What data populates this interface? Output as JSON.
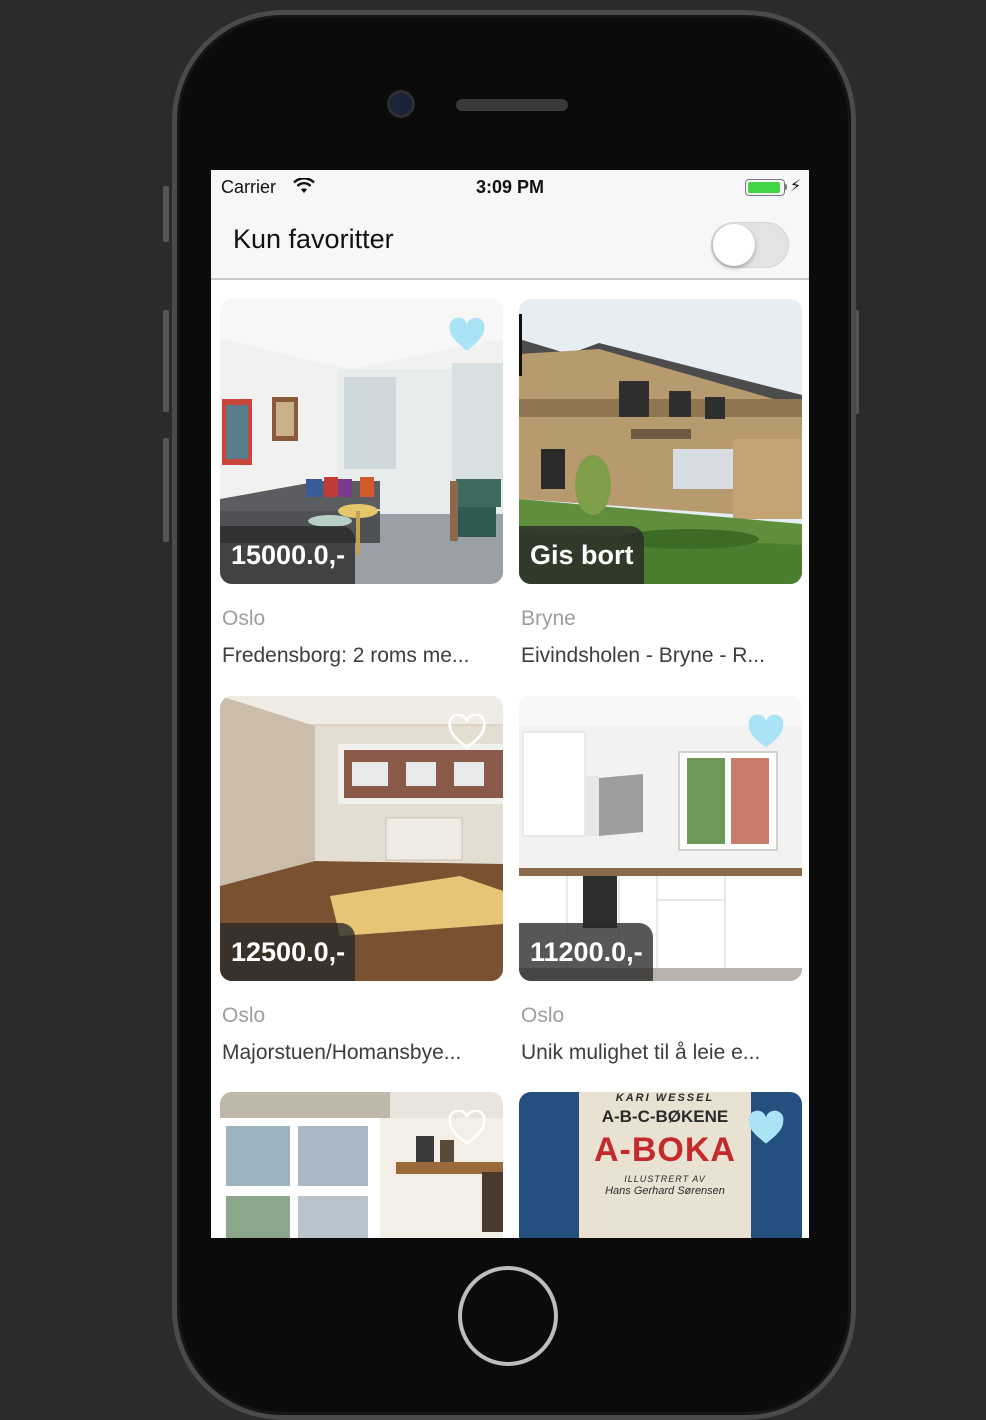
{
  "status_bar": {
    "carrier": "Carrier",
    "time": "3:09 PM"
  },
  "nav": {
    "title": "Kun favoritter",
    "favorites_only": false
  },
  "colors": {
    "heart_fill": "#a9e3f5",
    "heart_outline": "#ffffff",
    "battery": "#44d448"
  },
  "listings": [
    {
      "price": "15000.0,-",
      "city": "Oslo",
      "description": "Fredensborg: 2 roms me...",
      "favorite": true,
      "icon": "heart-icon"
    },
    {
      "price": "Gis bort",
      "city": "Bryne",
      "description": "Eivindsholen - Bryne - R...",
      "favorite": null,
      "icon": "heart-icon"
    },
    {
      "price": "12500.0,-",
      "city": "Oslo",
      "description": "Majorstuen/Homansbye...",
      "favorite": false,
      "icon": "heart-icon"
    },
    {
      "price": "11200.0,-",
      "city": "Oslo",
      "description": "Unik mulighet til å leie e...",
      "favorite": true,
      "icon": "heart-icon"
    },
    {
      "favorite": false,
      "icon": "heart-icon"
    },
    {
      "favorite": true,
      "icon": "heart-icon",
      "book_text": [
        "KARI WESSEL",
        "A-B-C-BØKENE",
        "A-BOKA",
        "ILLUSTRERT AV",
        "Hans Gerhard Sørensen"
      ]
    }
  ]
}
